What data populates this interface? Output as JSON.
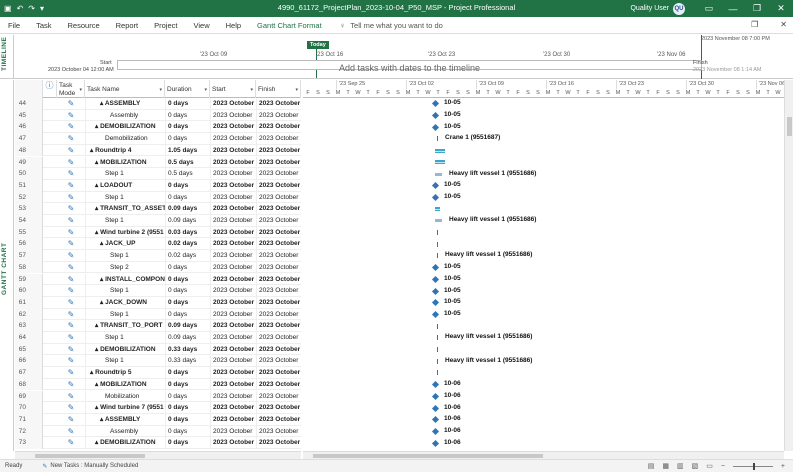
{
  "titlebar": {
    "title": "4990_61172_ProjectPlan_2023-10-04_P50_MSP  -  Project Professional",
    "user": "Quality User",
    "user_initials": "QU",
    "qa_icons": [
      "save-icon",
      "undo-icon",
      "redo-icon",
      "customize-icon"
    ],
    "window_controls": {
      "minimize": "—",
      "restore": "❐",
      "close": "✕",
      "ribbon": "▭"
    }
  },
  "menu": {
    "items": [
      "File",
      "Task",
      "Resource",
      "Report",
      "Project",
      "View",
      "Help"
    ],
    "contextual": "Gantt Chart Format",
    "tell_me": "Tell me what you want to do"
  },
  "timeline": {
    "side_label": "TIMELINE",
    "today": "Today",
    "start_label": "Start",
    "start_date": "2023 October 04 12:00 AM",
    "finish_label": "Finish",
    "finish_date": "2023 November 08 1:14 AM",
    "top_right": "2023 November 08 7:00 PM",
    "placeholder": "Add tasks with dates to the timeline",
    "ticks": [
      "'23 Oct 09",
      "'23 Oct 16",
      "'23 Oct 23",
      "'23 Oct 30",
      "'23 Nov 06"
    ]
  },
  "grid": {
    "side_label": "GANTT CHART",
    "headers": {
      "mode": "Task Mode",
      "name": "Task Name",
      "duration": "Duration",
      "start": "Start",
      "finish": "Finish"
    },
    "rows": [
      {
        "id": "44",
        "name": "▴ ASSEMBLY",
        "indent": 1,
        "bold": true,
        "duration": "0 days",
        "start": "2023 October",
        "finish": "2023 October"
      },
      {
        "id": "45",
        "name": "Assembly",
        "indent": 3,
        "bold": false,
        "duration": "0 days",
        "start": "2023 October",
        "finish": "2023 October"
      },
      {
        "id": "46",
        "name": "▴ DEMOBILIZATION",
        "indent": 0,
        "bold": true,
        "duration": "0 days",
        "start": "2023 October",
        "finish": "2023 October"
      },
      {
        "id": "47",
        "name": "Demobilization",
        "indent": 2,
        "bold": false,
        "duration": "0 days",
        "start": "2023 October",
        "finish": "2023 October"
      },
      {
        "id": "48",
        "name": "▴ Roundtrip 4",
        "indent": -1,
        "bold": true,
        "duration": "1.05 days",
        "start": "2023 October",
        "finish": "2023 October"
      },
      {
        "id": "49",
        "name": "▴ MOBILIZATION",
        "indent": 0,
        "bold": true,
        "duration": "0.5 days",
        "start": "2023 October",
        "finish": "2023 October"
      },
      {
        "id": "50",
        "name": "Step 1",
        "indent": 2,
        "bold": false,
        "duration": "0.5 days",
        "start": "2023 October",
        "finish": "2023 October"
      },
      {
        "id": "51",
        "name": "▴ LOADOUT",
        "indent": 0,
        "bold": true,
        "duration": "0 days",
        "start": "2023 October",
        "finish": "2023 October"
      },
      {
        "id": "52",
        "name": "Step 1",
        "indent": 2,
        "bold": false,
        "duration": "0 days",
        "start": "2023 October",
        "finish": "2023 October"
      },
      {
        "id": "53",
        "name": "▴ TRANSIT_TO_ASSET",
        "indent": 0,
        "bold": true,
        "duration": "0.09 days",
        "start": "2023 October",
        "finish": "2023 October"
      },
      {
        "id": "54",
        "name": "Step 1",
        "indent": 2,
        "bold": false,
        "duration": "0.09 days",
        "start": "2023 October",
        "finish": "2023 October"
      },
      {
        "id": "55",
        "name": "▴ Wind turbine 2 (9551",
        "indent": 0,
        "bold": true,
        "duration": "0.03 days",
        "start": "2023 October",
        "finish": "2023 October"
      },
      {
        "id": "56",
        "name": "▴ JACK_UP",
        "indent": 1,
        "bold": true,
        "duration": "0.02 days",
        "start": "2023 October",
        "finish": "2023 October"
      },
      {
        "id": "57",
        "name": "Step 1",
        "indent": 3,
        "bold": false,
        "duration": "0.02 days",
        "start": "2023 October",
        "finish": "2023 October"
      },
      {
        "id": "58",
        "name": "Step 2",
        "indent": 3,
        "bold": false,
        "duration": "0 days",
        "start": "2023 October",
        "finish": "2023 October"
      },
      {
        "id": "59",
        "name": "▴ INSTALL_COMPON",
        "indent": 1,
        "bold": true,
        "duration": "0 days",
        "start": "2023 October",
        "finish": "2023 October"
      },
      {
        "id": "60",
        "name": "Step 1",
        "indent": 3,
        "bold": false,
        "duration": "0 days",
        "start": "2023 October",
        "finish": "2023 October"
      },
      {
        "id": "61",
        "name": "▴ JACK_DOWN",
        "indent": 1,
        "bold": true,
        "duration": "0 days",
        "start": "2023 October",
        "finish": "2023 October"
      },
      {
        "id": "62",
        "name": "Step 1",
        "indent": 3,
        "bold": false,
        "duration": "0 days",
        "start": "2023 October",
        "finish": "2023 October"
      },
      {
        "id": "63",
        "name": "▴ TRANSIT_TO_PORT",
        "indent": 0,
        "bold": true,
        "duration": "0.09 days",
        "start": "2023 October",
        "finish": "2023 October"
      },
      {
        "id": "64",
        "name": "Step 1",
        "indent": 2,
        "bold": false,
        "duration": "0.09 days",
        "start": "2023 October",
        "finish": "2023 October"
      },
      {
        "id": "65",
        "name": "▴ DEMOBILIZATION",
        "indent": 0,
        "bold": true,
        "duration": "0.33 days",
        "start": "2023 October",
        "finish": "2023 October"
      },
      {
        "id": "66",
        "name": "Step 1",
        "indent": 2,
        "bold": false,
        "duration": "0.33 days",
        "start": "2023 October",
        "finish": "2023 October"
      },
      {
        "id": "67",
        "name": "▴ Roundtrip 5",
        "indent": -1,
        "bold": true,
        "duration": "0 days",
        "start": "2023 October",
        "finish": "2023 October"
      },
      {
        "id": "68",
        "name": "▴ MOBILIZATION",
        "indent": 0,
        "bold": true,
        "duration": "0 days",
        "start": "2023 October",
        "finish": "2023 October"
      },
      {
        "id": "69",
        "name": "Mobilization",
        "indent": 2,
        "bold": false,
        "duration": "0 days",
        "start": "2023 October",
        "finish": "2023 October"
      },
      {
        "id": "70",
        "name": "▴ Wind turbine 7 (9551",
        "indent": 0,
        "bold": true,
        "duration": "0 days",
        "start": "2023 October",
        "finish": "2023 October"
      },
      {
        "id": "71",
        "name": "▴ ASSEMBLY",
        "indent": 1,
        "bold": true,
        "duration": "0 days",
        "start": "2023 October",
        "finish": "2023 October"
      },
      {
        "id": "72",
        "name": "Assembly",
        "indent": 3,
        "bold": false,
        "duration": "0 days",
        "start": "2023 October",
        "finish": "2023 October"
      },
      {
        "id": "73",
        "name": "▴ DEMOBILIZATION",
        "indent": 0,
        "bold": true,
        "duration": "0 days",
        "start": "2023 October",
        "finish": "2023 October"
      }
    ]
  },
  "chart": {
    "weeks": [
      "'23 Sep 25",
      "'23 Oct 02",
      "'23 Oct 09",
      "'23 Oct 16",
      "'23 Oct 23",
      "'23 Oct 30",
      "'23 Nov 06"
    ],
    "day_letters": [
      "F",
      "S",
      "S",
      "M",
      "T",
      "W",
      "T",
      "F",
      "S",
      "S",
      "M",
      "T",
      "W",
      "T",
      "F",
      "S",
      "S",
      "M",
      "T",
      "W",
      "T",
      "F",
      "S",
      "S",
      "M",
      "T",
      "W",
      "T",
      "F",
      "S",
      "S",
      "M",
      "T",
      "W",
      "T",
      "F",
      "S",
      "S",
      "M",
      "T",
      "W",
      "T",
      "F",
      "S",
      "S",
      "M",
      "T",
      "W"
    ],
    "bars": [
      {
        "type": "milestone",
        "label": "10-05"
      },
      {
        "type": "milestone",
        "label": "10-05"
      },
      {
        "type": "milestone",
        "label": "10-05"
      },
      {
        "type": "tick",
        "label": "Crane 1 (9551687)"
      },
      {
        "type": "summary",
        "label": ""
      },
      {
        "type": "summary",
        "label": ""
      },
      {
        "type": "task",
        "label": "Heavy lift vessel 1 (9551686)"
      },
      {
        "type": "milestone",
        "label": "10-05"
      },
      {
        "type": "milestone",
        "label": "10-05"
      },
      {
        "type": "summary",
        "label": ""
      },
      {
        "type": "task",
        "label": "Heavy lift vessel 1 (9551686)"
      },
      {
        "type": "tick",
        "label": ""
      },
      {
        "type": "tick",
        "label": ""
      },
      {
        "type": "tick",
        "label": "Heavy lift vessel 1 (9551686)"
      },
      {
        "type": "milestone",
        "label": "10-05"
      },
      {
        "type": "milestone",
        "label": "10-05"
      },
      {
        "type": "milestone",
        "label": "10-05"
      },
      {
        "type": "milestone",
        "label": "10-05"
      },
      {
        "type": "milestone",
        "label": "10-05"
      },
      {
        "type": "tick",
        "label": ""
      },
      {
        "type": "tick",
        "label": "Heavy lift vessel 1 (9551686)"
      },
      {
        "type": "tick",
        "label": ""
      },
      {
        "type": "tick",
        "label": "Heavy lift vessel 1 (9551686)"
      },
      {
        "type": "tick",
        "label": ""
      },
      {
        "type": "milestone",
        "label": "10-06"
      },
      {
        "type": "milestone",
        "label": "10-06"
      },
      {
        "type": "milestone",
        "label": "10-06"
      },
      {
        "type": "milestone",
        "label": "10-06"
      },
      {
        "type": "milestone",
        "label": "10-06"
      },
      {
        "type": "milestone",
        "label": "10-06"
      }
    ]
  },
  "status": {
    "ready": "Ready",
    "new_tasks": "New Tasks : Manually Scheduled"
  }
}
